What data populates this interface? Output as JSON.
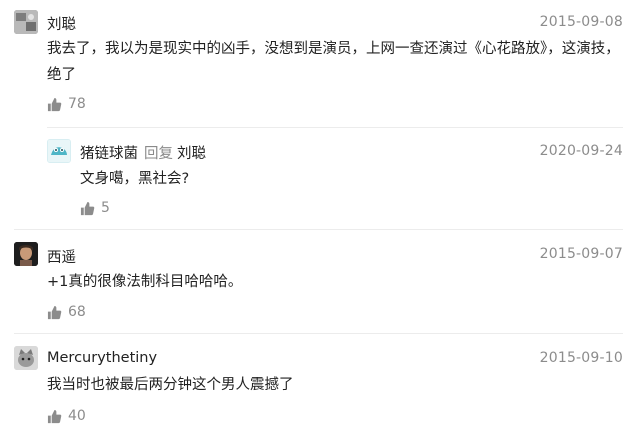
{
  "comments": [
    {
      "name": "刘聪",
      "date": "2015-09-08",
      "text": "我去了，我以为是现实中的凶手，没想到是演员，上网一查还演过《心花路放》，这演技，绝了",
      "likes": "78",
      "reply": {
        "name": "猪链球菌",
        "reply_word": "回复",
        "reply_to": "刘聪",
        "date": "2020-09-24",
        "text": "文身噶，黑社会?",
        "likes": "5"
      }
    },
    {
      "name": "西遥",
      "date": "2015-09-07",
      "text": "+1真的很像法制科目哈哈哈。",
      "likes": "68"
    },
    {
      "name": "Mercurythetiny",
      "date": "2015-09-10",
      "text": "我当时也被最后两分钟这个男人震撼了",
      "likes": "40"
    }
  ],
  "icons": {
    "like": "thumbs-up-icon"
  },
  "colors": {
    "name": "#222222",
    "meta": "#8c8c8c",
    "reply_word": "#8a8a8a",
    "divider": "#ececec",
    "avatar_teal": "#4fb6c7"
  }
}
